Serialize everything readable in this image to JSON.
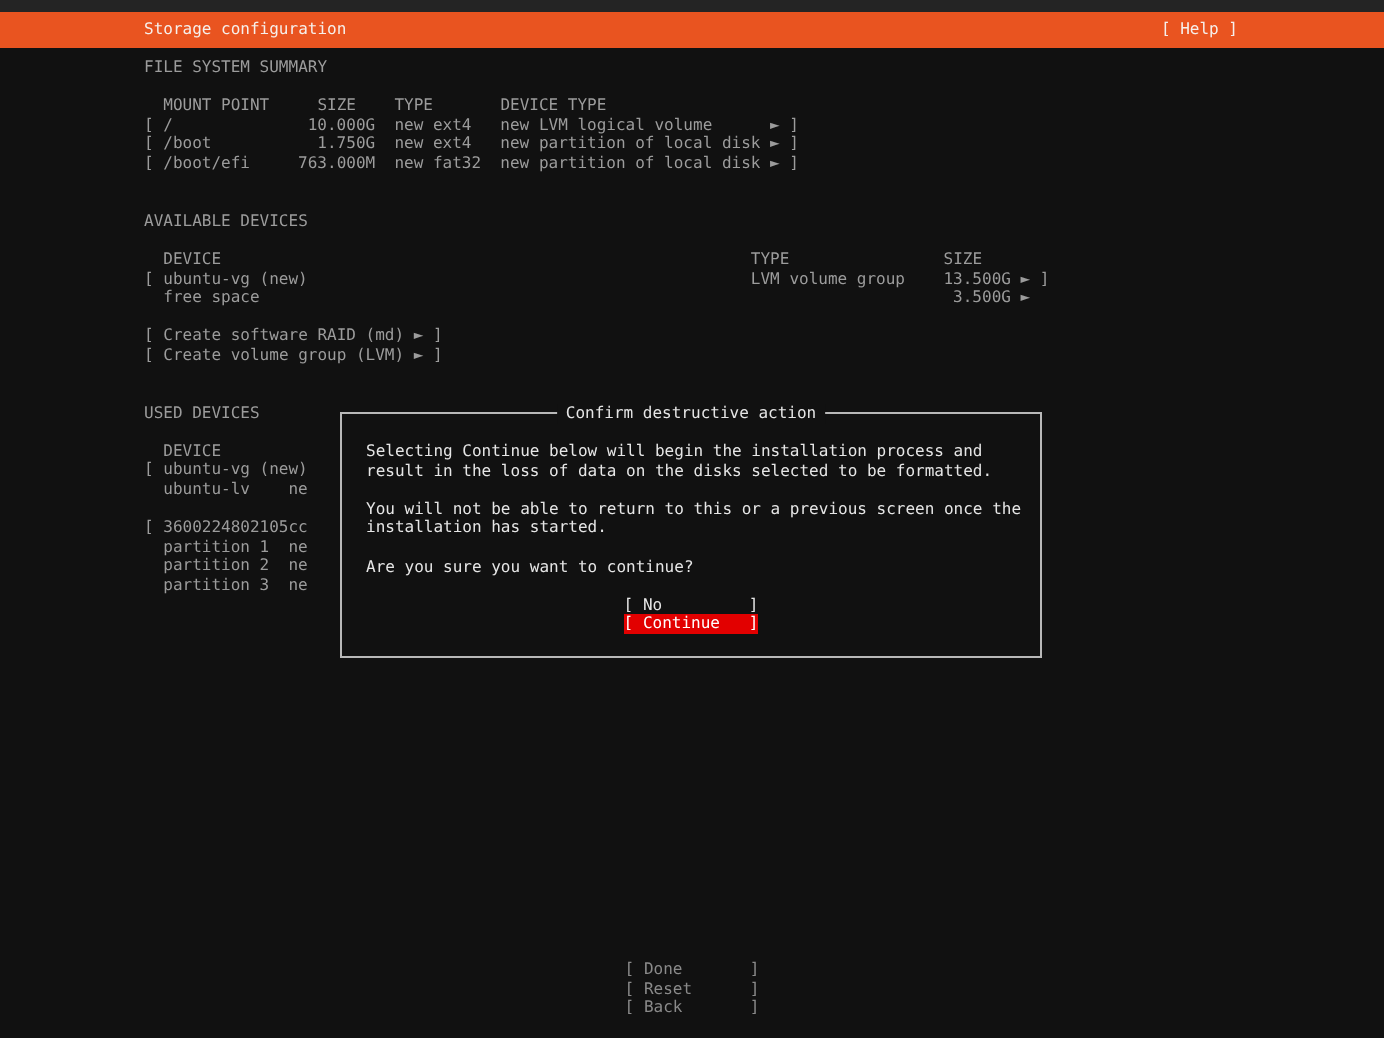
{
  "header": {
    "title": "Storage configuration",
    "help": "[ Help ]"
  },
  "file_system_summary": {
    "title": "FILE SYSTEM SUMMARY",
    "columns": [
      "MOUNT POINT",
      "SIZE",
      "TYPE",
      "DEVICE TYPE"
    ],
    "rows": [
      {
        "open": "[",
        "mount_point": "/",
        "size": "10.000G",
        "type": "new ext4",
        "device_type": "new LVM logical volume",
        "arrow": "►",
        "close": "]"
      },
      {
        "open": "[",
        "mount_point": "/boot",
        "size": "1.750G",
        "type": "new ext4",
        "device_type": "new partition of local disk",
        "arrow": "►",
        "close": "]"
      },
      {
        "open": "[",
        "mount_point": "/boot/efi",
        "size": "763.000M",
        "type": "new fat32",
        "device_type": "new partition of local disk",
        "arrow": "►",
        "close": "]"
      }
    ]
  },
  "available_devices": {
    "title": "AVAILABLE DEVICES",
    "columns": [
      "DEVICE",
      "TYPE",
      "SIZE"
    ],
    "rows": [
      {
        "open": "[",
        "device": "ubuntu-vg (new)",
        "type": "LVM volume group",
        "size": "13.500G",
        "arrow": "►",
        "close": "]"
      },
      {
        "device": "free space",
        "size": "3.500G",
        "arrow": "►"
      }
    ],
    "actions": [
      {
        "open": "[",
        "label": "Create software RAID (md)",
        "arrow": "►",
        "close": "]"
      },
      {
        "open": "[",
        "label": "Create volume group (LVM)",
        "arrow": "►",
        "close": "]"
      }
    ]
  },
  "used_devices": {
    "title": "USED DEVICES",
    "columns": [
      "DEVICE"
    ],
    "groups": [
      [
        {
          "open": "[",
          "device": "ubuntu-vg (new)"
        },
        {
          "device": "ubuntu-lv",
          "column_2": "ne"
        }
      ],
      [
        {
          "open": "[",
          "device": "3600224802105cc"
        },
        {
          "device": "partition 1",
          "column_2": "ne"
        },
        {
          "device": "partition 2",
          "column_2": "ne"
        },
        {
          "device": "partition 3",
          "column_2": "ne"
        }
      ]
    ]
  },
  "dialog": {
    "title": "Confirm destructive action",
    "paragraphs": [
      "Selecting Continue below will begin the installation process and result in the loss of data on the disks selected to be formatted.",
      "You will not be able to return to this or a previous screen once the installation has started.",
      "Are you sure you want to continue?"
    ],
    "buttons": [
      {
        "open": "[",
        "label": "No",
        "close": "]",
        "selected": false
      },
      {
        "open": "[",
        "label": "Continue",
        "close": "]",
        "selected": true
      }
    ]
  },
  "footer_buttons": [
    {
      "open": "[",
      "label": "Done",
      "close": "]"
    },
    {
      "open": "[",
      "label": "Reset",
      "close": "]"
    },
    {
      "open": "[",
      "label": "Back",
      "close": "]"
    }
  ]
}
